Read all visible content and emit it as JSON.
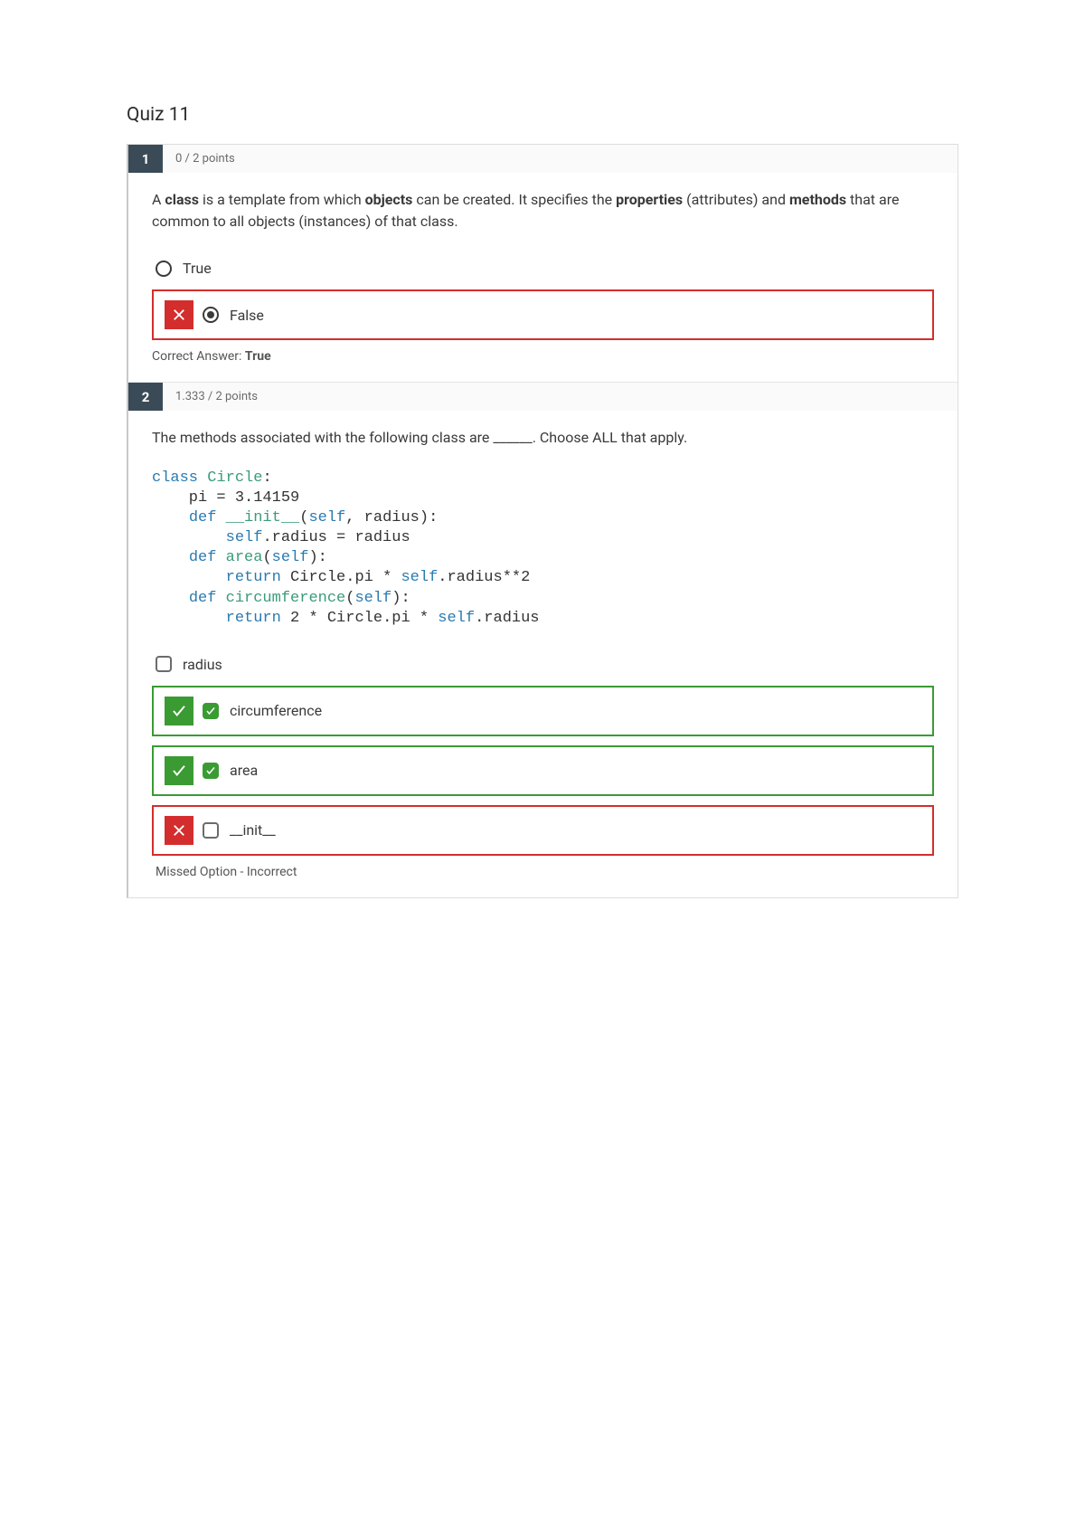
{
  "title": "Quiz 11",
  "questions": [
    {
      "number": "1",
      "points": "0 / 2 points",
      "prompt_parts": [
        "A ",
        "class",
        " is a template from which ",
        "objects",
        " can be created. It specifies the ",
        "properties",
        " (attributes) and ",
        "methods",
        " that are common to all objects (instances) of that class."
      ],
      "answers": [
        {
          "type": "radio",
          "label": "True",
          "selected": false
        },
        {
          "type": "radio",
          "label": "False",
          "selected": true,
          "mark": "wrong"
        }
      ],
      "correct_answer_label": "Correct Answer:",
      "correct_answer_value": "True"
    },
    {
      "number": "2",
      "points": "1.333 / 2 points",
      "prompt_text": "The methods associated with the following class are ______. Choose ALL that apply.",
      "code_lines": [
        [
          {
            "t": "class ",
            "c": "kw"
          },
          {
            "t": "Circle",
            "c": "cls"
          },
          {
            "t": ":",
            "c": ""
          }
        ],
        [
          {
            "t": "    pi = 3.14159",
            "c": ""
          }
        ],
        [
          {
            "t": "    ",
            "c": ""
          },
          {
            "t": "def ",
            "c": "kw"
          },
          {
            "t": "__init__",
            "c": "fn"
          },
          {
            "t": "(",
            "c": ""
          },
          {
            "t": "self",
            "c": "self"
          },
          {
            "t": ", radius):",
            "c": ""
          }
        ],
        [
          {
            "t": "        ",
            "c": ""
          },
          {
            "t": "self",
            "c": "self"
          },
          {
            "t": ".radius = radius",
            "c": ""
          }
        ],
        [
          {
            "t": "    ",
            "c": ""
          },
          {
            "t": "def ",
            "c": "kw"
          },
          {
            "t": "area",
            "c": "fn"
          },
          {
            "t": "(",
            "c": ""
          },
          {
            "t": "self",
            "c": "self"
          },
          {
            "t": "):",
            "c": ""
          }
        ],
        [
          {
            "t": "        ",
            "c": ""
          },
          {
            "t": "return ",
            "c": "kw"
          },
          {
            "t": "Circle.pi * ",
            "c": ""
          },
          {
            "t": "self",
            "c": "self"
          },
          {
            "t": ".radius**2",
            "c": ""
          }
        ],
        [
          {
            "t": "    ",
            "c": ""
          },
          {
            "t": "def ",
            "c": "kw"
          },
          {
            "t": "circumference",
            "c": "fn"
          },
          {
            "t": "(",
            "c": ""
          },
          {
            "t": "self",
            "c": "self"
          },
          {
            "t": "):",
            "c": ""
          }
        ],
        [
          {
            "t": "        ",
            "c": ""
          },
          {
            "t": "return ",
            "c": "kw"
          },
          {
            "t": "2 * Circle.pi * ",
            "c": ""
          },
          {
            "t": "self",
            "c": "self"
          },
          {
            "t": ".radius",
            "c": ""
          }
        ]
      ],
      "answers": [
        {
          "type": "checkbox",
          "label": "radius",
          "checked": false
        },
        {
          "type": "checkbox",
          "label": "circumference",
          "checked": true,
          "mark": "correct"
        },
        {
          "type": "checkbox",
          "label": "area",
          "checked": true,
          "mark": "correct"
        },
        {
          "type": "checkbox",
          "label": "__init__",
          "checked": false,
          "mark": "wrong"
        }
      ],
      "feedback": "Missed Option - Incorrect"
    }
  ]
}
